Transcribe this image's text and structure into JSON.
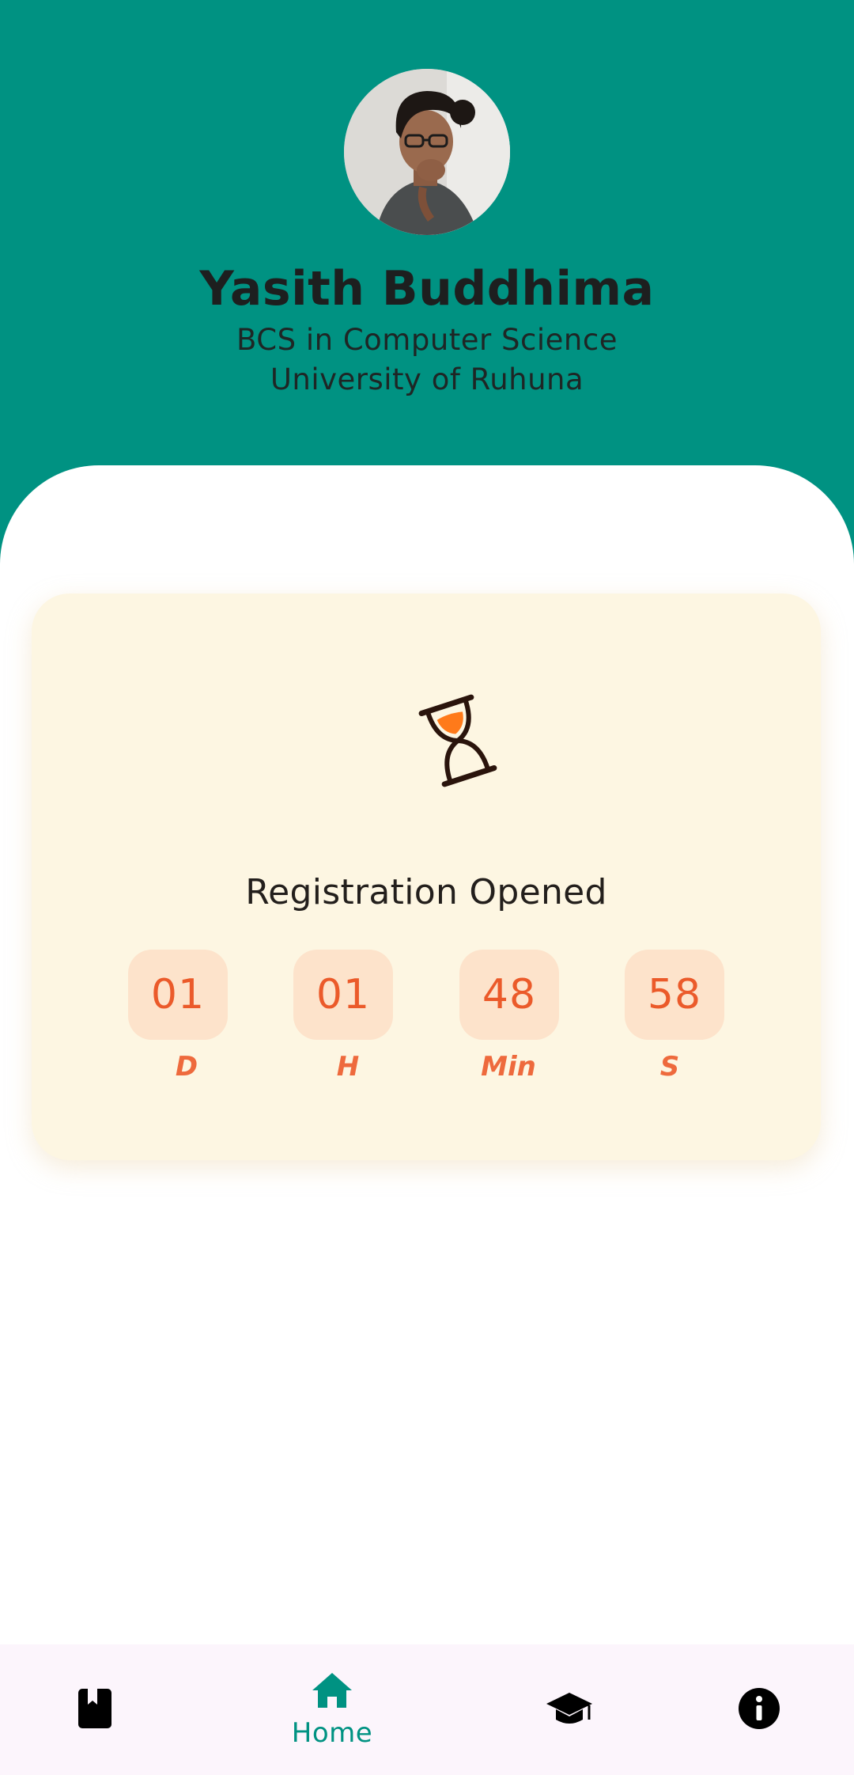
{
  "profile": {
    "name": "Yasith Buddhima",
    "degree": "BCS in Computer Science",
    "university": "University of Ruhuna"
  },
  "countdown": {
    "icon": "hourglass-icon",
    "title": "Registration Opened",
    "units": [
      {
        "value": "01",
        "label": "D"
      },
      {
        "value": "01",
        "label": "H"
      },
      {
        "value": "48",
        "label": "Min"
      },
      {
        "value": "58",
        "label": "S"
      }
    ]
  },
  "bottom_nav": {
    "active_index": 1,
    "items": [
      {
        "icon": "book-icon",
        "label": ""
      },
      {
        "icon": "home-icon",
        "label": "Home"
      },
      {
        "icon": "graduation-cap-icon",
        "label": ""
      },
      {
        "icon": "info-icon",
        "label": ""
      }
    ]
  },
  "colors": {
    "header_bg": "#009282",
    "card_bg": "#fdf6e2",
    "tile_bg": "#fde3cb",
    "accent_orange": "#eb5a2a",
    "nav_active": "#009282",
    "nav_bg": "#fcf5fc"
  }
}
